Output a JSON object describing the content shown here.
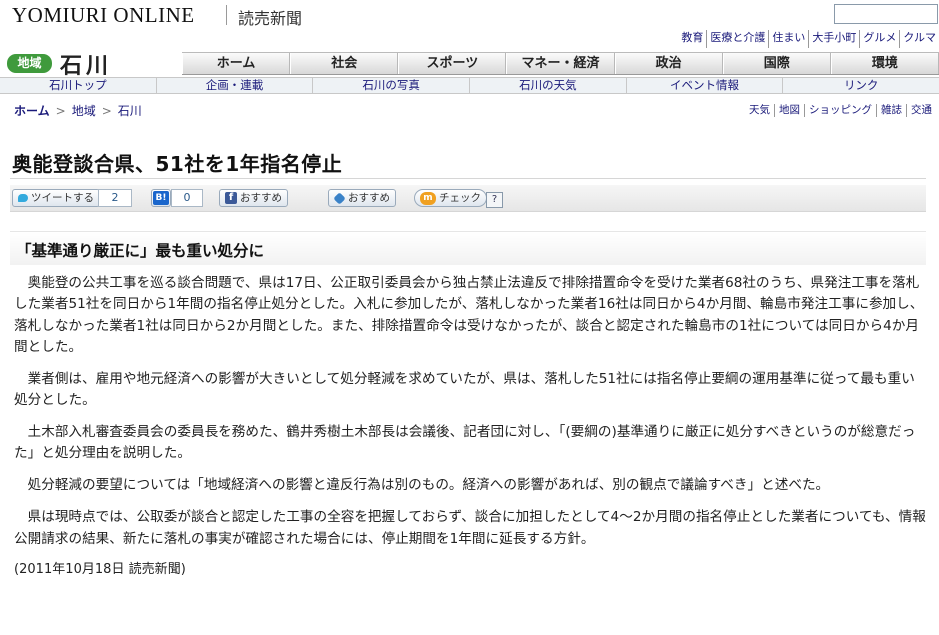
{
  "header": {
    "logo": "YOMIURI ONLINE",
    "brand_jp": "読売新聞",
    "search_placeholder": ""
  },
  "top_links": [
    "教育",
    "医療と介護",
    "住まい",
    "大手小町",
    "グルメ",
    "クルマ"
  ],
  "region": {
    "badge": "地域",
    "name": "石川"
  },
  "main_nav": [
    "ホーム",
    "社会",
    "スポーツ",
    "マネー・経済",
    "政治",
    "国際",
    "環境"
  ],
  "sub_nav": [
    "石川トップ",
    "企画・連載",
    "石川の写真",
    "石川の天気",
    "イベント情報",
    "リンク"
  ],
  "breadcrumb": {
    "home": "ホーム",
    "sep": ">",
    "area": "地域",
    "current": "石川"
  },
  "util_links": [
    "天気",
    "地図",
    "ショッピング",
    "雑誌",
    "交通"
  ],
  "article": {
    "headline": "奥能登談合県、51社を1年指名停止",
    "subhead": "「基準通り厳正に」最も重い処分に",
    "paragraphs": [
      "奥能登の公共工事を巡る談合問題で、県は17日、公正取引委員会から独占禁止法違反で排除措置命令を受けた業者68社のうち、県発注工事を落札した業者51社を同日から1年間の指名停止処分とした。入札に参加したが、落札しなかった業者16社は同日から4か月間、輪島市発注工事に参加し、落札しなかった業者1社は同日から2か月間とした。また、排除措置命令は受けなかったが、談合と認定された輪島市の1社については同日から4か月間とした。",
      "業者側は、雇用や地元経済への影響が大きいとして処分軽減を求めていたが、県は、落札した51社には指名停止要綱の運用基準に従って最も重い処分とした。",
      "土木部入札審査委員会の委員長を務めた、鶴井秀樹土木部長は会議後、記者団に対し、「(要綱の)基準通りに厳正に処分すべきというのが総意だった」と処分理由を説明した。",
      "処分軽減の要望については「地域経済への影響と違反行為は別のもの。経済への影響があれば、別の観点で議論すべき」と述べた。",
      "県は現時点では、公取委が談合と認定した工事の全容を把握しておらず、談合に加担したとして4〜2か月間の指名停止とした業者についても、情報公開請求の結果、新たに落札の事実が確認された場合には、停止期間を1年間に延長する方針。"
    ],
    "dateline": "(2011年10月18日  読売新聞)"
  },
  "social": {
    "tweet_label": "ツイートする",
    "tweet_count": "2",
    "hatena_label": "B!",
    "hatena_count": "0",
    "fb_label": "おすすめ",
    "recommend_label": "おすすめ",
    "check_label": "チェック",
    "help_label": "?"
  },
  "colors": {
    "region_badge": "#3f9a3c",
    "link": "#1a1a7a",
    "facebook": "#3b5998",
    "twitter": "#33aadd",
    "hatena": "#1a66cc"
  }
}
